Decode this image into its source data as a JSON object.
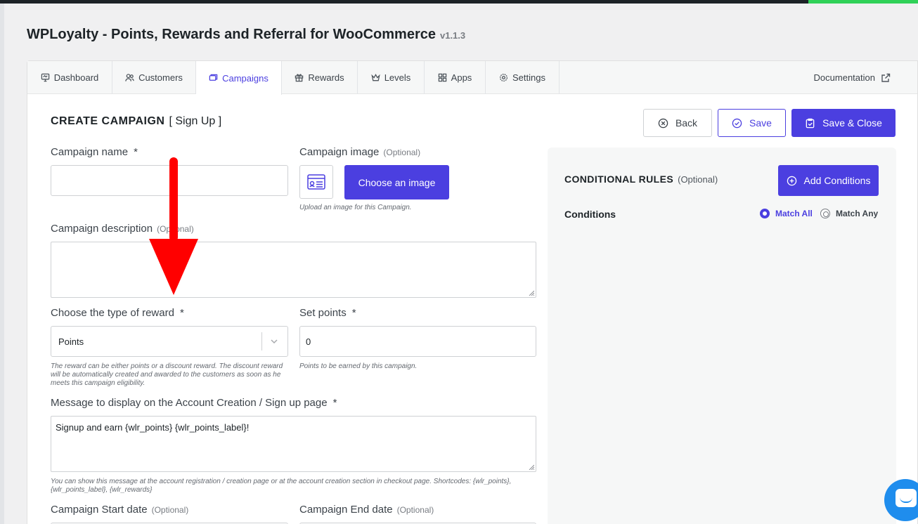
{
  "header": {
    "title": "WPLoyalty - Points, Rewards and Referral for WooCommerce",
    "version": "v1.1.3"
  },
  "tabs": [
    {
      "label": "Dashboard",
      "icon": "dashboard-icon"
    },
    {
      "label": "Customers",
      "icon": "customers-icon"
    },
    {
      "label": "Campaigns",
      "icon": "campaigns-icon",
      "active": true
    },
    {
      "label": "Rewards",
      "icon": "rewards-icon"
    },
    {
      "label": "Levels",
      "icon": "levels-icon"
    },
    {
      "label": "Apps",
      "icon": "apps-icon"
    },
    {
      "label": "Settings",
      "icon": "settings-icon"
    }
  ],
  "documentation_label": "Documentation",
  "form": {
    "heading": "CREATE CAMPAIGN",
    "campaign_kind": "[ Sign Up ]",
    "buttons": {
      "back": "Back",
      "save": "Save",
      "save_close": "Save & Close"
    },
    "campaign_name": {
      "label": "Campaign name",
      "required": "*",
      "value": ""
    },
    "campaign_image": {
      "label": "Campaign image",
      "optional": "(Optional)",
      "button": "Choose an image",
      "help": "Upload an image for this Campaign."
    },
    "campaign_description": {
      "label": "Campaign description",
      "optional": "(Optional)",
      "value": ""
    },
    "reward_type": {
      "label": "Choose the type of reward",
      "required": "*",
      "value": "Points",
      "help": "The reward can be either points or a discount reward. The discount reward will be automatically created and awarded to the customers as soon as he meets this campaign eligibility."
    },
    "set_points": {
      "label": "Set points",
      "required": "*",
      "value": "0",
      "help": "Points to be earned by this campaign."
    },
    "message": {
      "label": "Message to display on the Account Creation / Sign up page",
      "required": "*",
      "value": "Signup and earn {wlr_points} {wlr_points_label}!",
      "help": "You can show this message at the account registration / creation page or at the account creation section in checkout page. Shortcodes: {wlr_points}, {wlr_points_label}, {wlr_rewards}"
    },
    "start_date": {
      "label": "Campaign Start date",
      "optional": "(Optional)"
    },
    "end_date": {
      "label": "Campaign End date",
      "optional": "(Optional)"
    }
  },
  "rules": {
    "title": "CONDITIONAL RULES",
    "optional": "(Optional)",
    "add_button": "Add Conditions",
    "conditions_label": "Conditions",
    "match_all": "Match All",
    "match_any": "Match Any",
    "selected": "Match All"
  },
  "colors": {
    "accent": "#4b3fe0",
    "annotation_arrow": "#ff0000",
    "chat": "#1f8ded"
  }
}
